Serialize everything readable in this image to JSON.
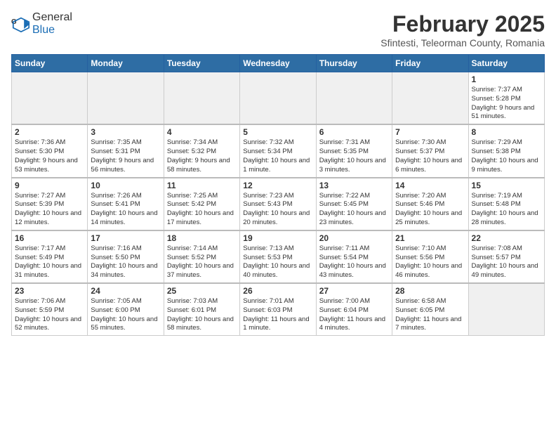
{
  "header": {
    "logo_general": "General",
    "logo_blue": "Blue",
    "month_title": "February 2025",
    "subtitle": "Sfintesti, Teleorman County, Romania"
  },
  "weekdays": [
    "Sunday",
    "Monday",
    "Tuesday",
    "Wednesday",
    "Thursday",
    "Friday",
    "Saturday"
  ],
  "weeks": [
    [
      {
        "day": "",
        "info": ""
      },
      {
        "day": "",
        "info": ""
      },
      {
        "day": "",
        "info": ""
      },
      {
        "day": "",
        "info": ""
      },
      {
        "day": "",
        "info": ""
      },
      {
        "day": "",
        "info": ""
      },
      {
        "day": "1",
        "info": "Sunrise: 7:37 AM\nSunset: 5:28 PM\nDaylight: 9 hours and 51 minutes."
      }
    ],
    [
      {
        "day": "2",
        "info": "Sunrise: 7:36 AM\nSunset: 5:30 PM\nDaylight: 9 hours and 53 minutes."
      },
      {
        "day": "3",
        "info": "Sunrise: 7:35 AM\nSunset: 5:31 PM\nDaylight: 9 hours and 56 minutes."
      },
      {
        "day": "4",
        "info": "Sunrise: 7:34 AM\nSunset: 5:32 PM\nDaylight: 9 hours and 58 minutes."
      },
      {
        "day": "5",
        "info": "Sunrise: 7:32 AM\nSunset: 5:34 PM\nDaylight: 10 hours and 1 minute."
      },
      {
        "day": "6",
        "info": "Sunrise: 7:31 AM\nSunset: 5:35 PM\nDaylight: 10 hours and 3 minutes."
      },
      {
        "day": "7",
        "info": "Sunrise: 7:30 AM\nSunset: 5:37 PM\nDaylight: 10 hours and 6 minutes."
      },
      {
        "day": "8",
        "info": "Sunrise: 7:29 AM\nSunset: 5:38 PM\nDaylight: 10 hours and 9 minutes."
      }
    ],
    [
      {
        "day": "9",
        "info": "Sunrise: 7:27 AM\nSunset: 5:39 PM\nDaylight: 10 hours and 12 minutes."
      },
      {
        "day": "10",
        "info": "Sunrise: 7:26 AM\nSunset: 5:41 PM\nDaylight: 10 hours and 14 minutes."
      },
      {
        "day": "11",
        "info": "Sunrise: 7:25 AM\nSunset: 5:42 PM\nDaylight: 10 hours and 17 minutes."
      },
      {
        "day": "12",
        "info": "Sunrise: 7:23 AM\nSunset: 5:43 PM\nDaylight: 10 hours and 20 minutes."
      },
      {
        "day": "13",
        "info": "Sunrise: 7:22 AM\nSunset: 5:45 PM\nDaylight: 10 hours and 23 minutes."
      },
      {
        "day": "14",
        "info": "Sunrise: 7:20 AM\nSunset: 5:46 PM\nDaylight: 10 hours and 25 minutes."
      },
      {
        "day": "15",
        "info": "Sunrise: 7:19 AM\nSunset: 5:48 PM\nDaylight: 10 hours and 28 minutes."
      }
    ],
    [
      {
        "day": "16",
        "info": "Sunrise: 7:17 AM\nSunset: 5:49 PM\nDaylight: 10 hours and 31 minutes."
      },
      {
        "day": "17",
        "info": "Sunrise: 7:16 AM\nSunset: 5:50 PM\nDaylight: 10 hours and 34 minutes."
      },
      {
        "day": "18",
        "info": "Sunrise: 7:14 AM\nSunset: 5:52 PM\nDaylight: 10 hours and 37 minutes."
      },
      {
        "day": "19",
        "info": "Sunrise: 7:13 AM\nSunset: 5:53 PM\nDaylight: 10 hours and 40 minutes."
      },
      {
        "day": "20",
        "info": "Sunrise: 7:11 AM\nSunset: 5:54 PM\nDaylight: 10 hours and 43 minutes."
      },
      {
        "day": "21",
        "info": "Sunrise: 7:10 AM\nSunset: 5:56 PM\nDaylight: 10 hours and 46 minutes."
      },
      {
        "day": "22",
        "info": "Sunrise: 7:08 AM\nSunset: 5:57 PM\nDaylight: 10 hours and 49 minutes."
      }
    ],
    [
      {
        "day": "23",
        "info": "Sunrise: 7:06 AM\nSunset: 5:59 PM\nDaylight: 10 hours and 52 minutes."
      },
      {
        "day": "24",
        "info": "Sunrise: 7:05 AM\nSunset: 6:00 PM\nDaylight: 10 hours and 55 minutes."
      },
      {
        "day": "25",
        "info": "Sunrise: 7:03 AM\nSunset: 6:01 PM\nDaylight: 10 hours and 58 minutes."
      },
      {
        "day": "26",
        "info": "Sunrise: 7:01 AM\nSunset: 6:03 PM\nDaylight: 11 hours and 1 minute."
      },
      {
        "day": "27",
        "info": "Sunrise: 7:00 AM\nSunset: 6:04 PM\nDaylight: 11 hours and 4 minutes."
      },
      {
        "day": "28",
        "info": "Sunrise: 6:58 AM\nSunset: 6:05 PM\nDaylight: 11 hours and 7 minutes."
      },
      {
        "day": "",
        "info": ""
      }
    ]
  ]
}
